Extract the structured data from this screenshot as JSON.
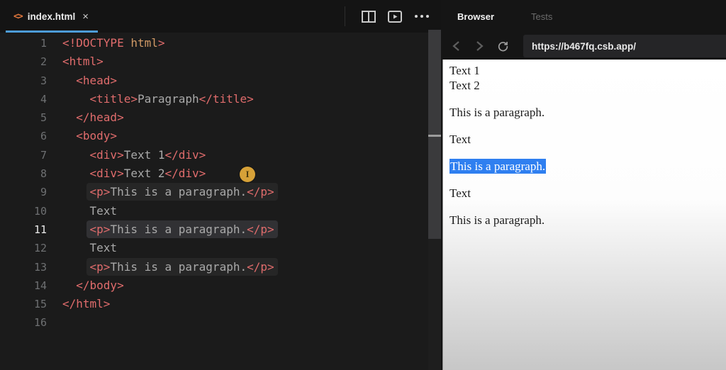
{
  "colors": {
    "accent_tab_underline": "#4d9cd8",
    "selection_blue": "#2f7ff0",
    "cursor_badge": "#d6a138",
    "syntax_tag_red": "#e06c6c",
    "syntax_attr_orange": "#d19a66",
    "syntax_plain_gray": "#a9a9a9"
  },
  "editor": {
    "tab": {
      "label": "index.html",
      "file_icon": "<>",
      "close_glyph": "×"
    },
    "toolbar": {
      "icons": [
        "split-editor",
        "open-preview",
        "more-actions"
      ]
    },
    "lines": [
      {
        "n": "1",
        "indent": "",
        "tokens": [
          {
            "c": "tag",
            "t": "<!DOCTYPE"
          },
          {
            "c": "attr",
            "t": " html"
          },
          {
            "c": "tag",
            "t": ">"
          }
        ]
      },
      {
        "n": "2",
        "indent": "",
        "tokens": [
          {
            "c": "tag",
            "t": "<html>"
          }
        ]
      },
      {
        "n": "3",
        "indent": "  ",
        "tokens": [
          {
            "c": "tag",
            "t": "<head>"
          }
        ]
      },
      {
        "n": "4",
        "indent": "    ",
        "tokens": [
          {
            "c": "tag",
            "t": "<title>"
          },
          {
            "c": "plain",
            "t": "Paragraph"
          },
          {
            "c": "tag",
            "t": "</title>"
          }
        ]
      },
      {
        "n": "5",
        "indent": "  ",
        "tokens": [
          {
            "c": "tag",
            "t": "</head>"
          }
        ]
      },
      {
        "n": "6",
        "indent": "  ",
        "tokens": [
          {
            "c": "tag",
            "t": "<body>"
          }
        ]
      },
      {
        "n": "7",
        "indent": "    ",
        "tokens": [
          {
            "c": "tag",
            "t": "<div>"
          },
          {
            "c": "plain",
            "t": "Text 1"
          },
          {
            "c": "tag",
            "t": "</div>"
          }
        ]
      },
      {
        "n": "8",
        "indent": "    ",
        "tokens": [
          {
            "c": "tag",
            "t": "<div>"
          },
          {
            "c": "plain",
            "t": "Text 2"
          },
          {
            "c": "tag",
            "t": "</div>"
          }
        ]
      },
      {
        "n": "9",
        "indent": "    ",
        "box": "dim",
        "tokens": [
          {
            "c": "tag",
            "t": "<p>"
          },
          {
            "c": "plain",
            "t": "This is a paragraph."
          },
          {
            "c": "tag",
            "t": "</p>"
          }
        ]
      },
      {
        "n": "10",
        "indent": "    ",
        "tokens": [
          {
            "c": "plain",
            "t": "Text"
          }
        ]
      },
      {
        "n": "11",
        "indent": "    ",
        "box": "bright",
        "active": true,
        "tokens": [
          {
            "c": "tag",
            "t": "<p>"
          },
          {
            "c": "plain",
            "t": "This is a paragraph."
          },
          {
            "c": "tag",
            "t": "</p>"
          }
        ]
      },
      {
        "n": "12",
        "indent": "    ",
        "tokens": [
          {
            "c": "plain",
            "t": "Text"
          }
        ]
      },
      {
        "n": "13",
        "indent": "    ",
        "box": "dim",
        "tokens": [
          {
            "c": "tag",
            "t": "<p>"
          },
          {
            "c": "plain",
            "t": "This is a paragraph."
          },
          {
            "c": "tag",
            "t": "</p>"
          }
        ]
      },
      {
        "n": "14",
        "indent": "  ",
        "tokens": [
          {
            "c": "tag",
            "t": "</body>"
          }
        ]
      },
      {
        "n": "15",
        "indent": "",
        "tokens": [
          {
            "c": "tag",
            "t": "</html>"
          }
        ]
      },
      {
        "n": "16",
        "indent": "",
        "tokens": []
      }
    ],
    "cursor_badge_glyph": "I"
  },
  "browser": {
    "tabs": [
      {
        "label": "Browser",
        "active": true
      },
      {
        "label": "Tests",
        "active": false
      }
    ],
    "url": "https://b467fq.csb.app/",
    "preview": {
      "items": [
        {
          "type": "div",
          "text": "Text 1"
        },
        {
          "type": "div",
          "text": "Text 2"
        },
        {
          "type": "p",
          "text": "This is a paragraph."
        },
        {
          "type": "text",
          "text": "Text"
        },
        {
          "type": "p",
          "text": "This is a paragraph.",
          "selected": true
        },
        {
          "type": "text",
          "text": "Text"
        },
        {
          "type": "p",
          "text": "This is a paragraph."
        }
      ]
    }
  }
}
